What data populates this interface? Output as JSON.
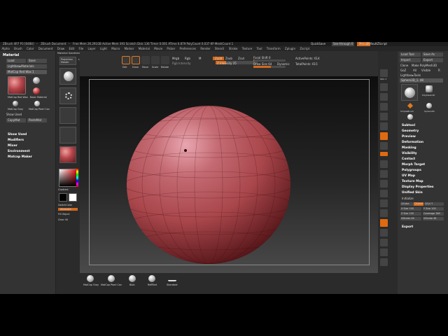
{
  "titlebar": {
    "title": "ZBrush 4R7 P3 [64Bit]",
    "doc": "ZBrush Document",
    "stats": "Free Mem 26.291GB  Active Mem 393  Scratch Disk 136  Timer 0.001  ATime 0.879  PolyCount 0.037 KP  MeshCount 1"
  },
  "quicksave": "QuickSave",
  "see_through": "See-through 0",
  "menus_label": "Menus",
  "default_script": "DefaultZScript",
  "menubar": [
    "Alpha",
    "Brush",
    "Color",
    "Document",
    "Draw",
    "Edit",
    "File",
    "Layer",
    "Light",
    "Macro",
    "Marker",
    "Material",
    "Movie",
    "Picker",
    "Preferences",
    "Render",
    "Stencil",
    "Stroke",
    "Texture",
    "Tool",
    "Transform",
    "Zplugin",
    "Zscript"
  ],
  "leftpanel": {
    "title": "Material",
    "load": "Load",
    "save": "Save",
    "lightbox_materials": "Lightbox▸Materials",
    "current": "MatCap Red Wax 1",
    "material_items": [
      "MatCap Red Wax",
      "Basic Material",
      "MatCap Gray",
      "MatCap Pearl Cav"
    ],
    "show_used": "Show Used",
    "copy_mat": "CopyMat",
    "paste_mat": "PasteMat",
    "sections": [
      "Show Used",
      "Modifiers",
      "Mixer",
      "Environment",
      "Matcap Maker"
    ]
  },
  "tray2": {
    "projection_master": "Projection Master",
    "lightbox": "LightBox",
    "material_name": "Material Subdivision Level",
    "gradient": "Gradient",
    "switch_color": "SwitchColor",
    "alternate": "Alternate",
    "fill_object": "Fill Object",
    "clear": "Clear 00"
  },
  "toptool": {
    "edit": "Edit",
    "draw": "Draw",
    "move": "Move",
    "scale": "Scale",
    "rotate": "Rotate",
    "mrgb": "Mrgb",
    "rgb": "Rgb",
    "m": "M",
    "rgb_intensity": "Rgb Intensity",
    "zadd": "Zadd",
    "zsub": "Zsub",
    "zcut": "Zcut",
    "z_intensity": "Z Intensity 25",
    "focal_shift": "Focal Shift 0",
    "draw_size": "Draw Size 64",
    "dynamic": "Dynamic",
    "active_points": "ActivePoints: 614",
    "total_points": "TotalPoints: 615"
  },
  "shelf": [
    "BPR",
    "SPix 3",
    "Scroll",
    "Zoom",
    "Actual",
    "AAHalf",
    "Dynamic",
    "Persp",
    "Floor",
    "Local",
    "LSym",
    "Xyz",
    "Frame",
    "Move",
    "Scale",
    "Rotate",
    "Line Fill",
    "PolyF",
    "Transp",
    "Ghost",
    "Solo",
    "Xpose"
  ],
  "bottomshelf": [
    "MatCap Gray",
    "MatCap Pearl Cav",
    "Blob",
    "ReflRed",
    "Standard"
  ],
  "rightpanel": {
    "title": "Tool",
    "load_tool": "Load Tool",
    "save_as": "Save As",
    "import": "Import",
    "export": "Export",
    "clone": "Clone",
    "make_polymesh": "Make PolyMesh3D",
    "goz": "GoZ",
    "all": "All",
    "visible": "Visible",
    "r": "R",
    "lightbox_tools": "Lightbox▸Tools",
    "current_tool": "Sphere3D_1. 48",
    "tools": [
      "Sphere3D_1",
      "PolyMesh3D",
      "SimpleBrush",
      "Sphere3D"
    ],
    "sections": [
      "Subtool",
      "Geometry",
      "Preview",
      "Deformation",
      "Masking",
      "Visibility",
      "Contact",
      "Morph Target",
      "Polygroups",
      "UV Map",
      "Texture Map",
      "Display Properties",
      "Unified Skin",
      "Initialize"
    ],
    "init_qcube": "QCube",
    "init_qsphere": "QSphere",
    "init_qcyl": "QCyl X",
    "init_qcyl_y": "QCyl Y",
    "x_size": "X Size 100",
    "y_size": "Y Size 100",
    "z_size": "Z Size 100",
    "coverage": "Coverage 360",
    "hdivide": "HDivide 48",
    "vdivide": "VDivide 48",
    "export_bottom": "Export"
  },
  "colors": {
    "accent": "#d2691e",
    "panel": "#333333",
    "red_wax": "#b5454a"
  }
}
